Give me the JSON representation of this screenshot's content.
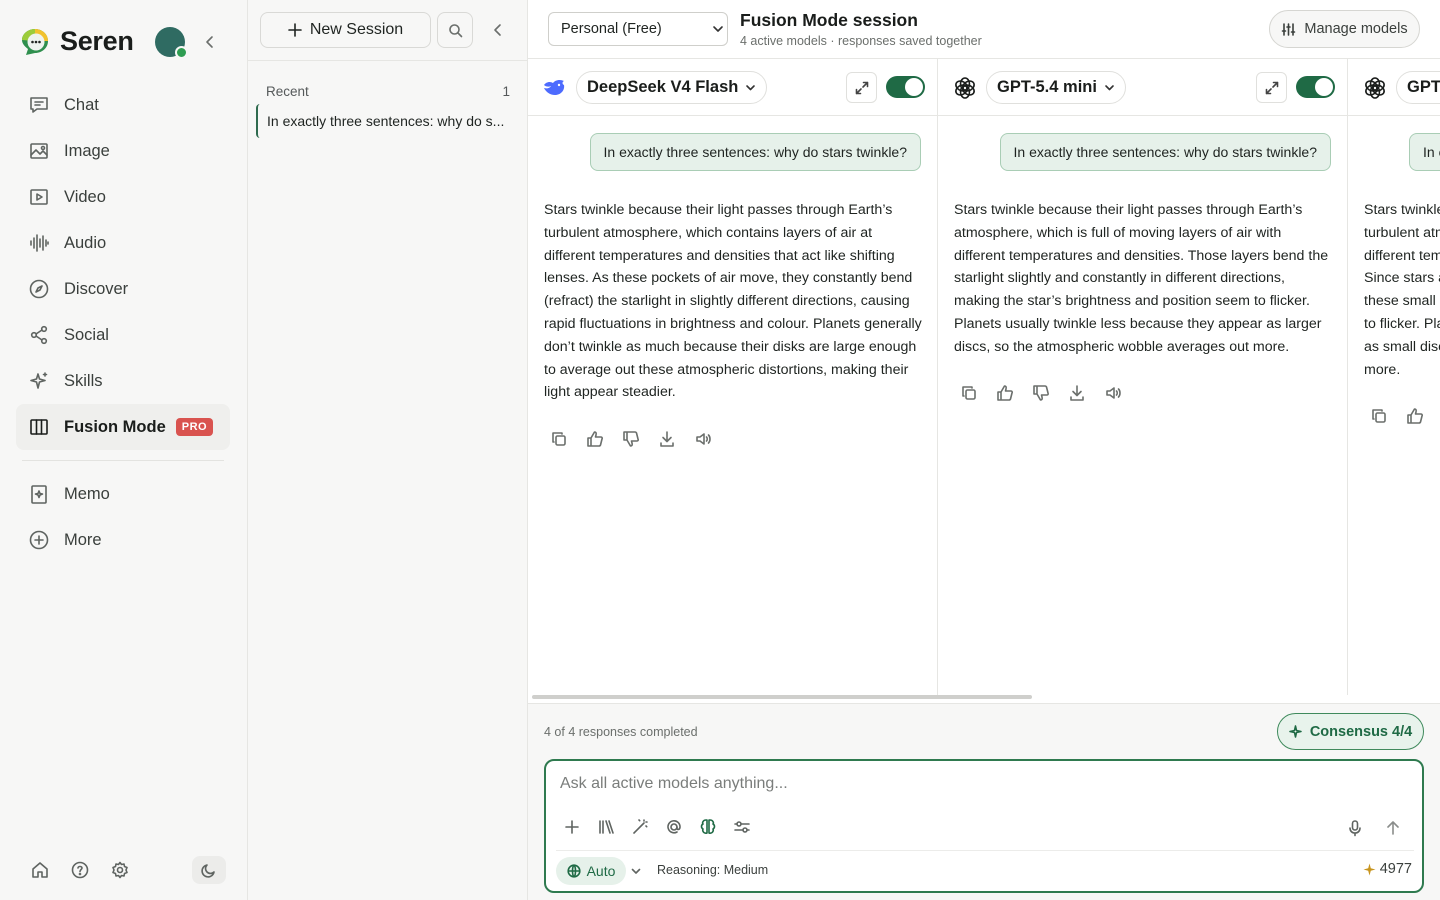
{
  "brand": {
    "name": "Seren"
  },
  "nav": {
    "items": [
      {
        "label": "Chat",
        "icon": "chat-icon"
      },
      {
        "label": "Image",
        "icon": "image-icon"
      },
      {
        "label": "Video",
        "icon": "video-icon"
      },
      {
        "label": "Audio",
        "icon": "audio-waveform-icon"
      },
      {
        "label": "Discover",
        "icon": "compass-icon"
      },
      {
        "label": "Social",
        "icon": "share-icon"
      },
      {
        "label": "Skills",
        "icon": "sparkles-icon"
      },
      {
        "label": "Fusion Mode",
        "icon": "columns-icon",
        "badge": "PRO",
        "active": true
      }
    ],
    "secondary": [
      {
        "label": "Memo",
        "icon": "memo-icon"
      },
      {
        "label": "More",
        "icon": "plus-circle-icon"
      }
    ]
  },
  "sessions": {
    "new_session_label": "New Session",
    "recent_label": "Recent",
    "recent_count": "1",
    "items": [
      {
        "title": "In exactly three sentences: why do s..."
      }
    ]
  },
  "header": {
    "workspace": "Personal (Free)",
    "title": "Fusion Mode session",
    "subtitle": "4 active models · responses saved together",
    "manage_models_label": "Manage models"
  },
  "columns": [
    {
      "model": "DeepSeek V4 Flash",
      "logo": "deepseek-whale-icon",
      "enabled": true,
      "prompt": "In exactly three sentences: why do stars twinkle?",
      "response": "Stars twinkle because their light passes through Earth’s turbulent atmosphere, which contains layers of air at different temperatures and densities that act like shifting lenses. As these pockets of air move, they constantly bend (refract) the starlight in slightly different directions, causing rapid fluctuations in brightness and colour. Planets generally don’t twinkle as much because their disks are large enough to average out these atmospheric distortions, making their light appear steadier."
    },
    {
      "model": "GPT-5.4 mini",
      "logo": "openai-logo-icon",
      "enabled": true,
      "prompt": "In exactly three sentences: why do stars twinkle?",
      "response": "Stars twinkle because their light passes through Earth’s atmosphere, which is full of moving layers of air with different temperatures and densities. Those layers bend the starlight slightly and constantly in different directions, making the star’s brightness and position seem to flicker. Planets usually twinkle less because they appear as larger discs, so the atmospheric wobble averages out more."
    },
    {
      "model": "GPT-",
      "logo": "openai-logo-icon",
      "prompt": "In e",
      "response_lines": [
        "Stars twinkle",
        "turbulent atm",
        "different tem",
        "Since stars a",
        "these small l",
        "to flicker. Pla",
        "as small disc",
        "more."
      ]
    }
  ],
  "footer": {
    "completed": "4 of 4 responses completed",
    "consensus_label": "Consensus 4/4"
  },
  "composer": {
    "placeholder": "Ask all active models anything...",
    "auto_label": "Auto",
    "reasoning": "Reasoning: Medium",
    "credits": "4977"
  },
  "colors": {
    "accent": "#1f6a45",
    "accent_light": "#e6f1ea",
    "pro_badge": "#d9534f",
    "sidebar_bg": "#f7f7f6"
  }
}
